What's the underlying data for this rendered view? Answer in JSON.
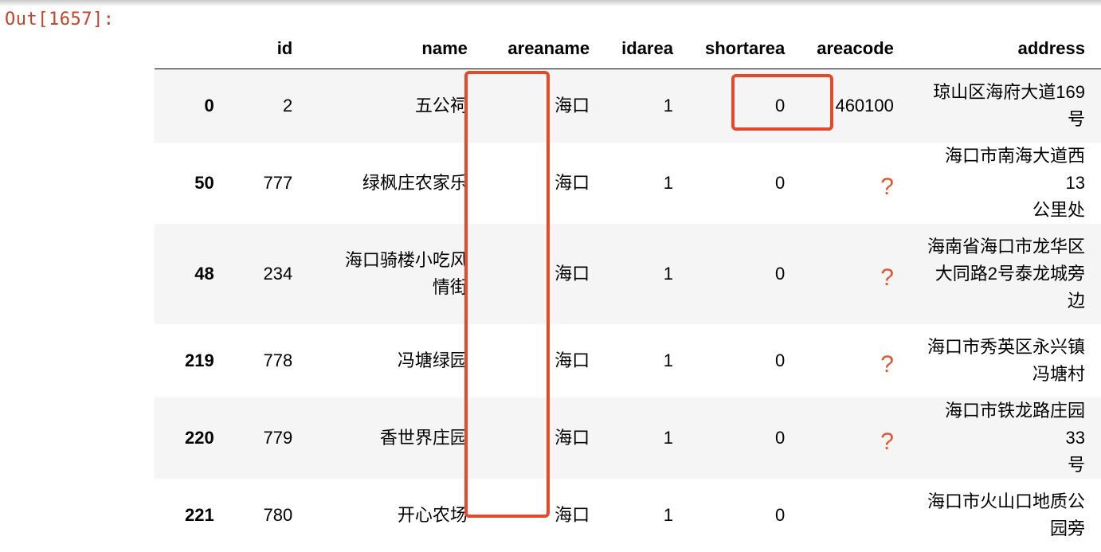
{
  "output_prompt": "Out[1657]:",
  "columns": {
    "index": "",
    "id": "id",
    "name": "name",
    "areaname": "areaname",
    "idarea": "idarea",
    "shortarea": "shortarea",
    "areacode": "areacode",
    "address": "address"
  },
  "rows": [
    {
      "index": "0",
      "id": "2",
      "name": [
        "五公祠"
      ],
      "areaname": "海口",
      "idarea": "1",
      "shortarea": "0",
      "areacode": "460100",
      "address": [
        "琼山区海府大道169",
        "号"
      ]
    },
    {
      "index": "50",
      "id": "777",
      "name": [
        "绿枫庄农家乐"
      ],
      "areaname": "海口",
      "idarea": "1",
      "shortarea": "0",
      "areacode": "?",
      "address": [
        "海口市南海大道西13",
        "公里处"
      ]
    },
    {
      "index": "48",
      "id": "234",
      "name": [
        "海口骑楼小吃风",
        "情街"
      ],
      "areaname": "海口",
      "idarea": "1",
      "shortarea": "0",
      "areacode": "?",
      "address": [
        "海南省海口市龙华区",
        "大同路2号泰龙城旁",
        "边"
      ]
    },
    {
      "index": "219",
      "id": "778",
      "name": [
        "冯塘绿园"
      ],
      "areaname": "海口",
      "idarea": "1",
      "shortarea": "0",
      "areacode": "?",
      "address": [
        "海口市秀英区永兴镇",
        "冯塘村"
      ]
    },
    {
      "index": "220",
      "id": "779",
      "name": [
        "香世界庄园"
      ],
      "areaname": "海口",
      "idarea": "1",
      "shortarea": "0",
      "areacode": "?",
      "address": [
        "海口市铁龙路庄园33",
        "号"
      ]
    },
    {
      "index": "221",
      "id": "780",
      "name": [
        "开心农场"
      ],
      "areaname": "海口",
      "idarea": "1",
      "shortarea": "0",
      "areacode": "",
      "address": [
        "海口市火山口地质公",
        "园旁"
      ]
    }
  ],
  "annotations": {
    "highlight_color": "#e44a2a",
    "question_mark_color": "#e2552e"
  }
}
